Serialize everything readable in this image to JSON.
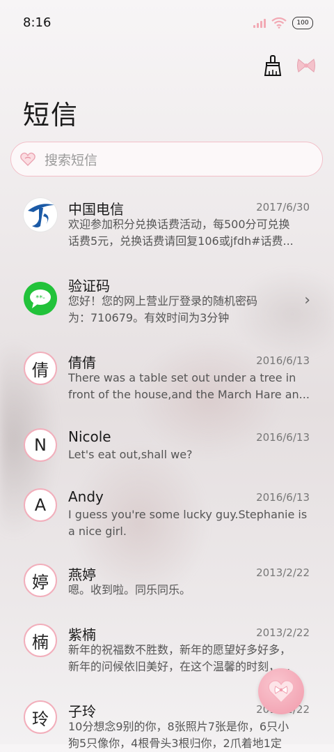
{
  "status": {
    "time": "8:16",
    "battery": "100"
  },
  "header": {
    "title": "短信"
  },
  "search": {
    "placeholder": "搜索短信"
  },
  "messages": [
    {
      "name": "中国电信",
      "date": "2017/6/30",
      "lines": [
        "欢迎参加积分兑换话费活动，每500分可兑换",
        "话费5元，兑换话费请回复106或jfdh#话费..."
      ],
      "avatar": ""
    },
    {
      "name": "验证码",
      "date": "",
      "lines": [
        "您好！您的网上营业厅登录的随机密码",
        "为：710679。有效时间为3分钟"
      ],
      "avatar": "**-"
    },
    {
      "name": "倩倩",
      "date": "2016/6/13",
      "lines": [
        "There was a table set out under a tree in",
        "front of the house,and the March Hare an..."
      ],
      "avatar": "倩"
    },
    {
      "name": "Nicole",
      "date": "2016/6/13",
      "lines": [
        "Let's eat out,shall we?"
      ],
      "avatar": "N"
    },
    {
      "name": "Andy",
      "date": "2016/6/13",
      "lines": [
        "I guess you're some lucky guy.Stephanie is",
        "a nice girl."
      ],
      "avatar": "A"
    },
    {
      "name": "燕婷",
      "date": "2013/2/22",
      "lines": [
        "嗯。收到啦。同乐同乐。"
      ],
      "avatar": "婷"
    },
    {
      "name": "紫楠",
      "date": "2013/2/22",
      "lines": [
        "新年的祝福数不胜数，新年的愿望好多好多，",
        "新年的问候依旧美好，在这个温馨的时刻，..."
      ],
      "avatar": "楠"
    },
    {
      "name": "子玲",
      "date": "2013/2/22",
      "lines": [
        "10分想念9别的你，8张照片7张是你，6只小",
        "狗5只像你，4根骨头3根归你，2爪着地1定"
      ],
      "avatar": "玲"
    }
  ],
  "colors": {
    "accent": "#f2aebb",
    "green": "#22c23a",
    "telecom_blue": "#1b5aa6"
  }
}
